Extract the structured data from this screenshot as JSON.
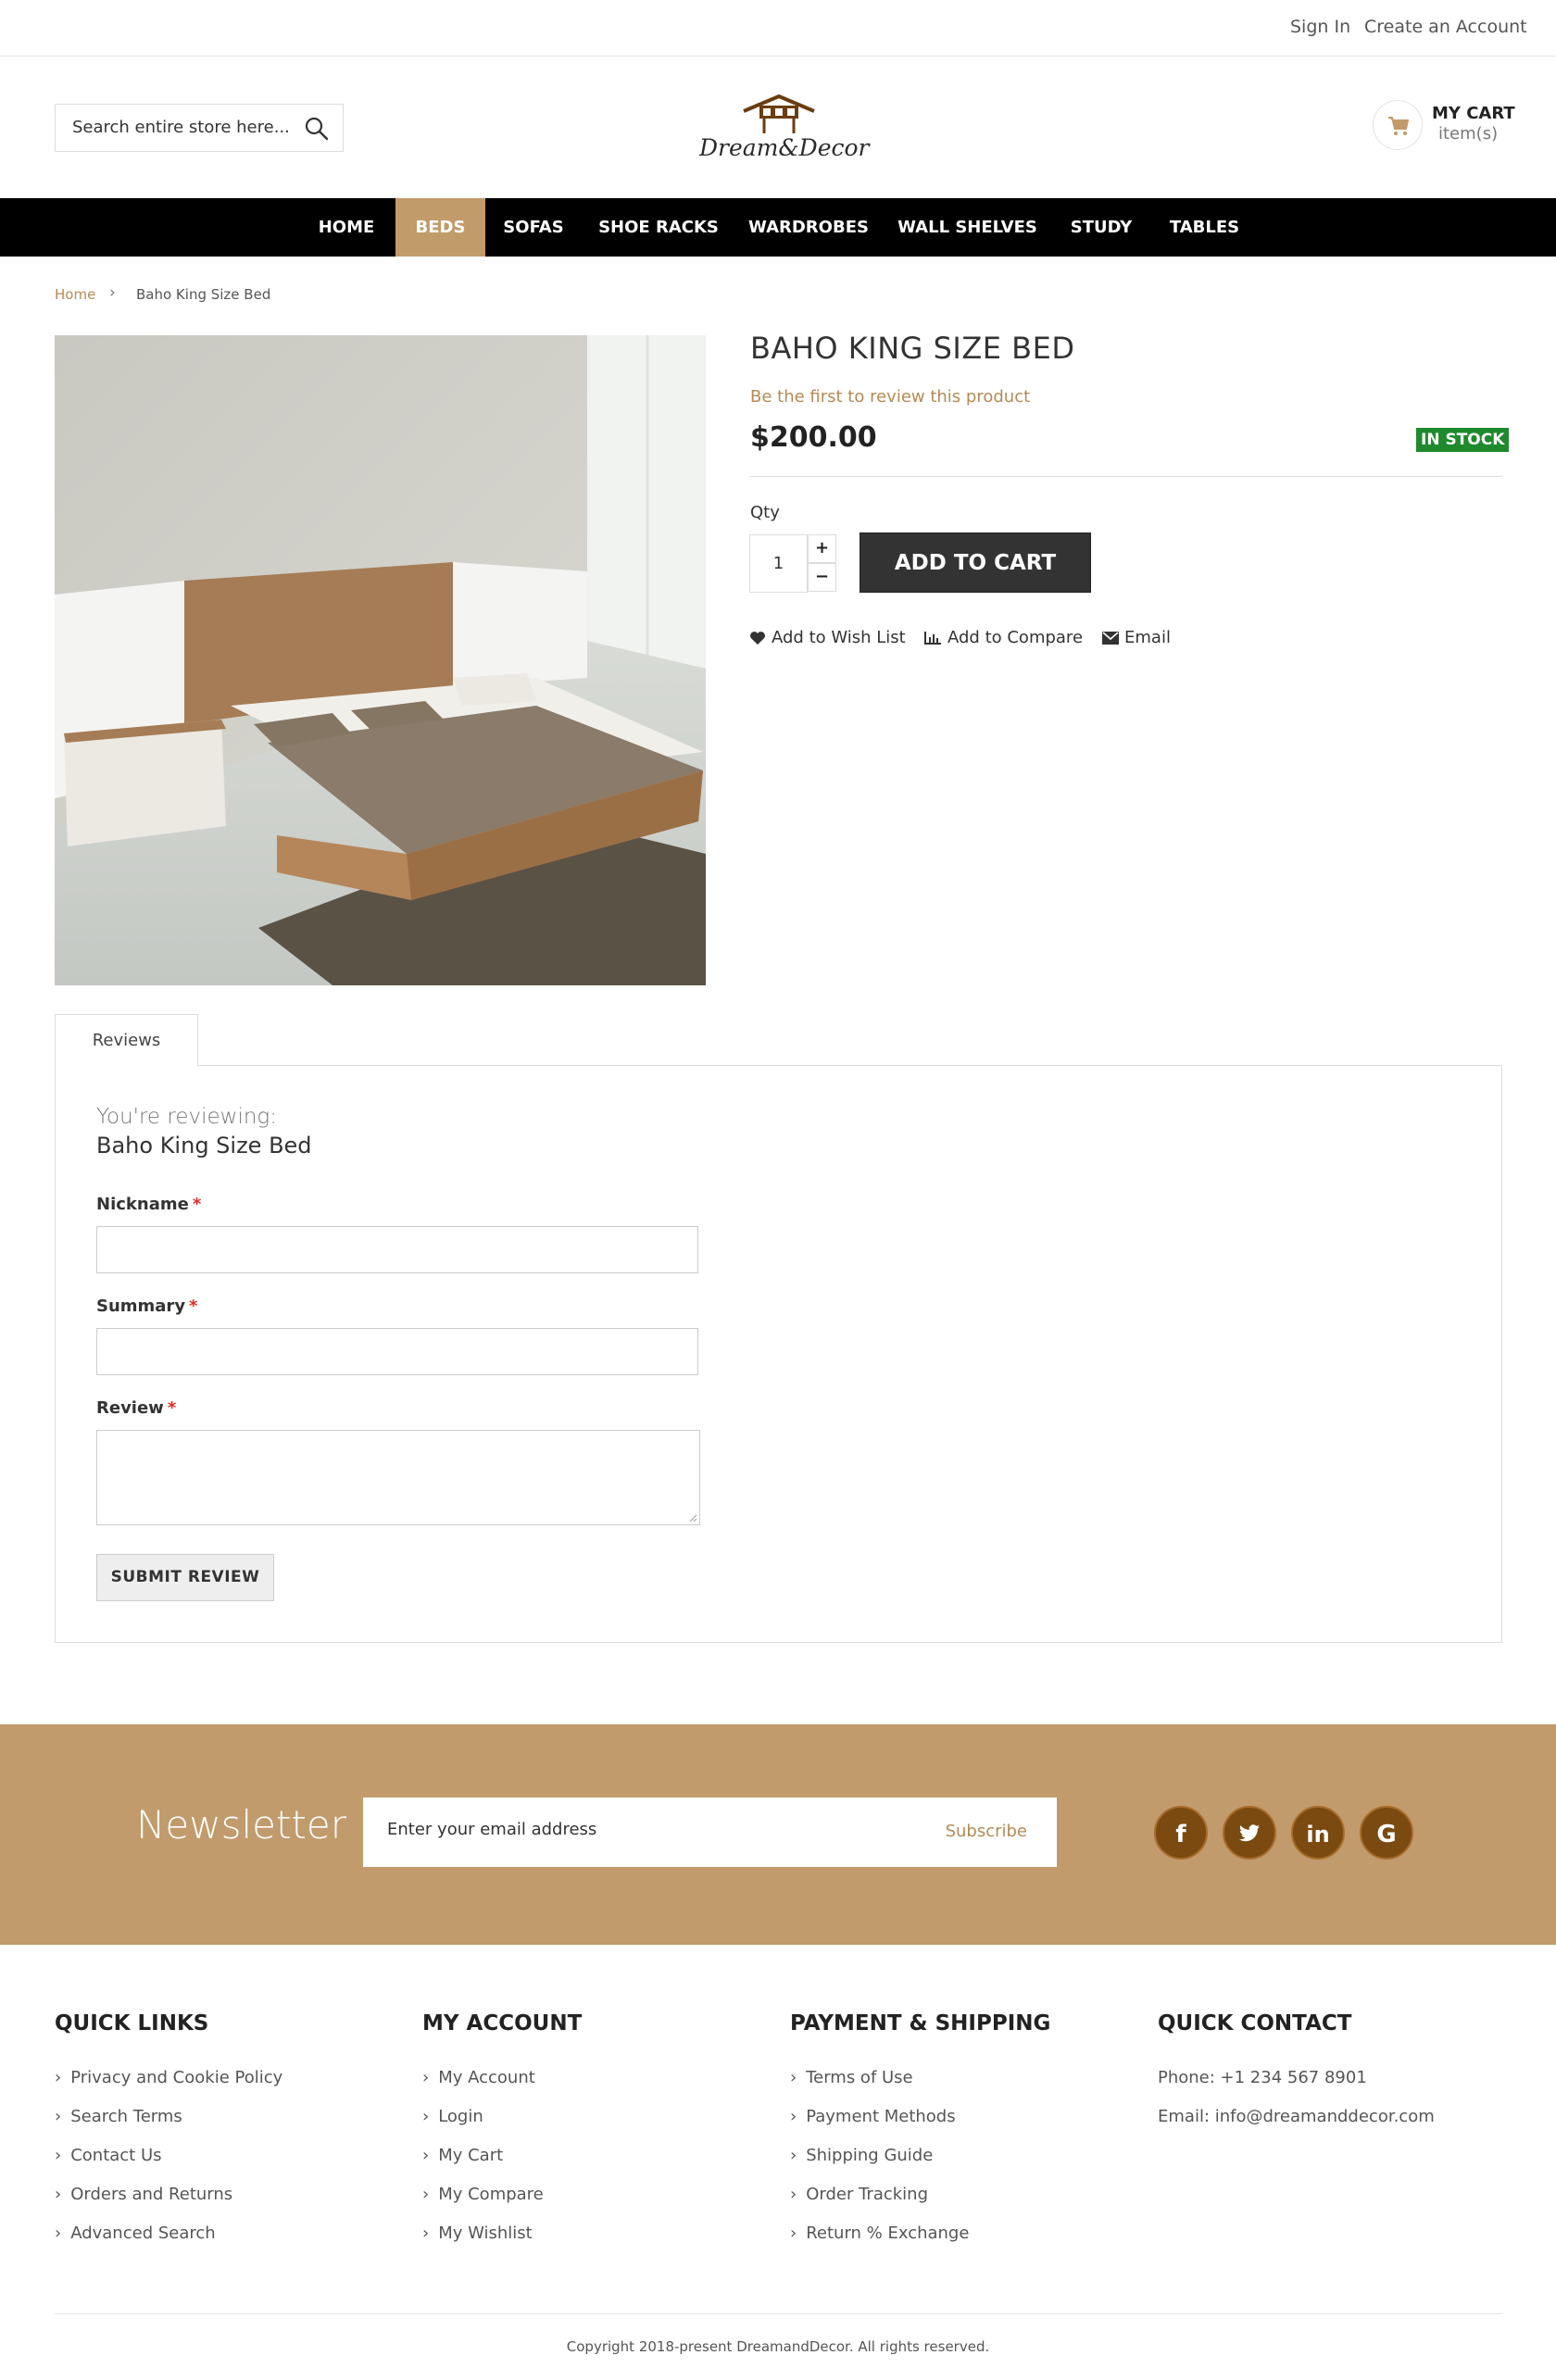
{
  "topbar": {
    "sign_in": "Sign In",
    "create_account": "Create an Account"
  },
  "header": {
    "search_placeholder": "Search entire store here...",
    "logo_text": "Dream&Decor",
    "cart_title": "MY CART",
    "cart_items": "item(s)"
  },
  "nav": {
    "items": [
      "HOME",
      "BEDS",
      "SOFAS",
      "SHOE RACKS",
      "WARDROBES",
      "WALL SHELVES",
      "STUDY",
      "TABLES"
    ],
    "active": "BEDS"
  },
  "breadcrumb": {
    "home": "Home",
    "current": "Baho King Size Bed"
  },
  "product": {
    "title": "BAHO KING SIZE BED",
    "review_link": "Be the first to review this product",
    "price": "$200.00",
    "stock": "IN STOCK",
    "qty_label": "Qty",
    "qty_value": "1",
    "add_to_cart": "ADD TO CART",
    "wishlist": "Add to Wish List",
    "compare": "Add to Compare",
    "email": "Email"
  },
  "reviews": {
    "tab": "Reviews",
    "lead": "You're reviewing:",
    "product_name": "Baho King Size Bed",
    "nickname_label": "Nickname",
    "summary_label": "Summary",
    "review_label": "Review",
    "required_mark": "*",
    "submit": "SUBMIT REVIEW"
  },
  "newsletter": {
    "title": "Newsletter",
    "placeholder": "Enter your email address",
    "subscribe": "Subscribe",
    "social": [
      "f",
      "twitter-icon",
      "in",
      "G"
    ]
  },
  "footer": {
    "quick_links": {
      "title": "QUICK LINKS",
      "items": [
        "Privacy and Cookie Policy",
        "Search Terms",
        "Contact Us",
        "Orders and Returns",
        "Advanced Search"
      ]
    },
    "my_account": {
      "title": "MY ACCOUNT",
      "items": [
        "My Account",
        "Login",
        "My Cart",
        "My Compare",
        "My Wishlist"
      ]
    },
    "payment": {
      "title": "PAYMENT & SHIPPING",
      "items": [
        "Terms of Use",
        "Payment Methods",
        "Shipping Guide",
        "Order Tracking",
        "Return % Exchange"
      ]
    },
    "contact": {
      "title": "QUICK CONTACT",
      "phone": "Phone: +1 234 567 8901",
      "email": "Email: info@dreamanddecor.com"
    },
    "copyright": "Copyright 2018-present DreamandDecor. All rights reserved."
  },
  "colors": {
    "accent": "#c29b6a",
    "nav_bg": "#000000",
    "stock_green": "#1e8a2c",
    "social_brown": "#7a4a10"
  }
}
